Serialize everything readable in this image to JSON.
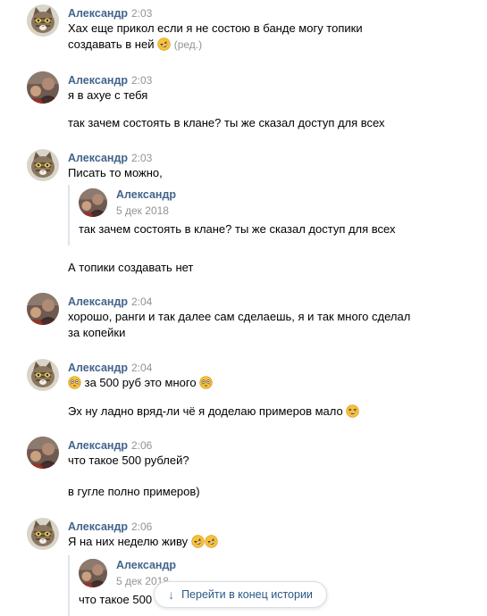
{
  "messages": [
    {
      "author": "Александр",
      "time": "2:03",
      "avatar": "cat",
      "lines": [
        "Хах еще прикол если я не состою в банде могу топики",
        "создавать в ней"
      ],
      "edited": "(ред.)"
    },
    {
      "author": "Александр",
      "time": "2:03",
      "avatar": "photo",
      "lines": [
        "я в ахуе с тебя",
        "так зачем состоять в клане? ты же сказал доступ для всех"
      ]
    },
    {
      "author": "Александр",
      "time": "2:03",
      "avatar": "cat",
      "lines": [
        "Писать то можно,",
        "А топики создавать нет"
      ],
      "quote": {
        "author": "Александр",
        "date": "5 дек 2018",
        "text": "так зачем состоять в клане? ты же сказал доступ для всех"
      }
    },
    {
      "author": "Александр",
      "time": "2:04",
      "avatar": "photo",
      "lines": [
        "хорошо, ранги и так далее сам сделаешь, я и так много сделал",
        "за копейки"
      ]
    },
    {
      "author": "Александр",
      "time": "2:04",
      "avatar": "cat",
      "lines": [
        "за 500 руб это много",
        "Эх ну ладно вряд-ли чё я доделаю примеров мало"
      ]
    },
    {
      "author": "Александр",
      "time": "2:06",
      "avatar": "photo",
      "lines": [
        "что такое 500 рублей?",
        "в гугле полно примеров)"
      ]
    },
    {
      "author": "Александр",
      "time": "2:06",
      "avatar": "cat",
      "lines": [
        "Я на них неделю живу"
      ],
      "quote": {
        "author": "Александр",
        "date": "5 дек 2018",
        "text": "что такое 500"
      }
    }
  ],
  "jump_button": {
    "label": "Перейти в конец истории",
    "icon": "arrow-down-icon"
  },
  "colors": {
    "author": "#42648b",
    "time": "#939393",
    "quote_border": "#dde4ec",
    "link": "#2a5885"
  },
  "emoji": {
    "rofl": "rofl-emoji",
    "flushed": "flushed-emoji",
    "laughing": "laughing-emoji"
  }
}
